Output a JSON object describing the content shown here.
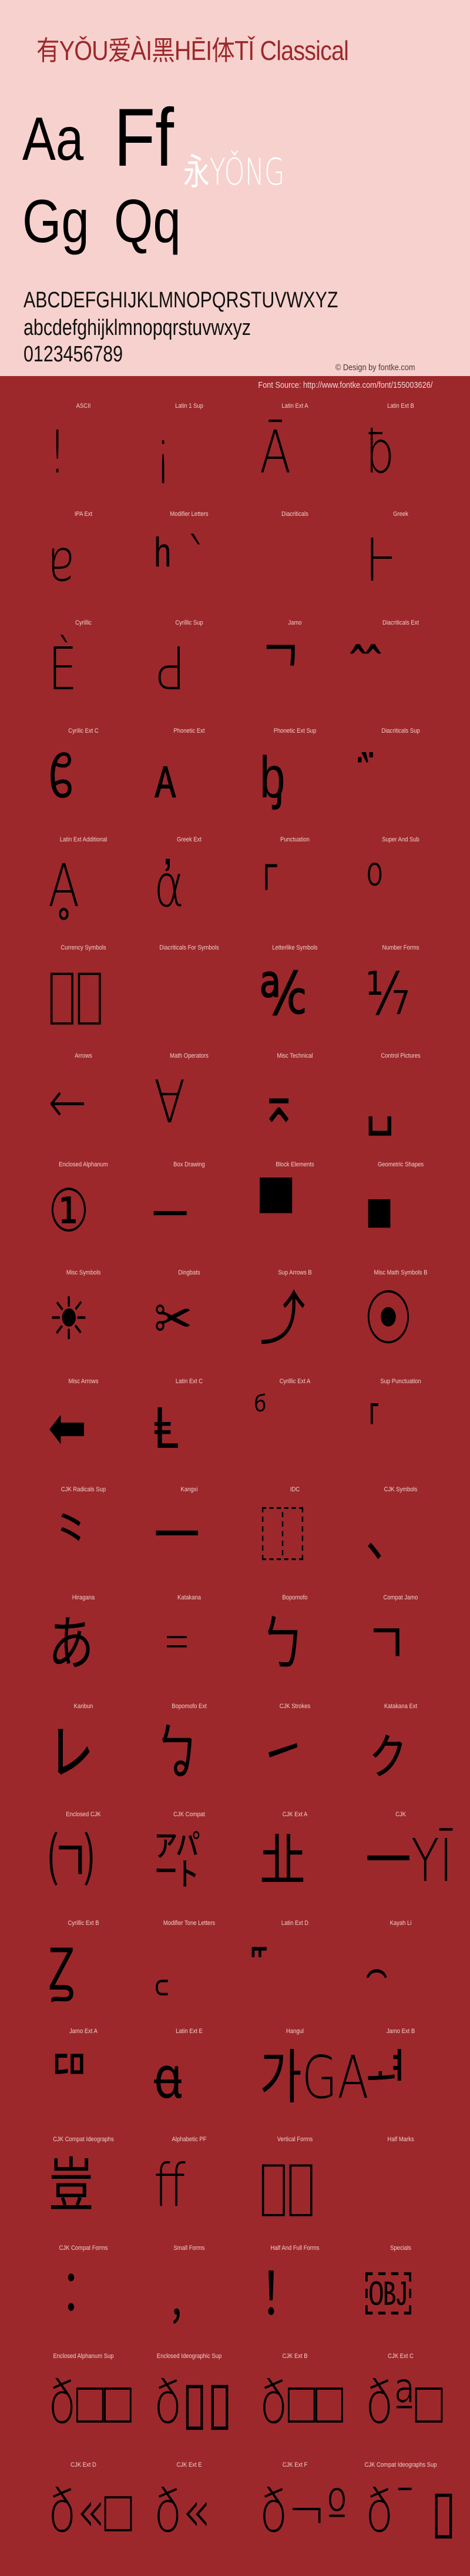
{
  "hero": {
    "title": "有YǑU爱ÀI黑HĒI体TǏ Classical",
    "specimen_pairs": [
      "Aa",
      "Ff",
      "Gg",
      "Qq"
    ],
    "yong": "永YǑNG",
    "uppercase": "ABCDEFGHIJKLMNOPQRSTUVWXYZ",
    "lowercase": "abcdefghijklmnopqrstuvwxyz",
    "digits": "0123456789",
    "copyright": "© Design by fontke.com",
    "source": "Font Source: http://www.fontke.com/font/155003626/"
  },
  "colors": {
    "hero_bg": "#F6D1CD",
    "grid_bg": "#9C282B",
    "title": "#9C282B",
    "yong": "#FFFFFF",
    "glyph": "#000000",
    "label": "#F1CFCB"
  },
  "blocks": [
    {
      "label": "ASCII",
      "glyph": "!"
    },
    {
      "label": "Latin 1 Sup",
      "glyph": "¡"
    },
    {
      "label": "Latin Ext A",
      "glyph": "Ā"
    },
    {
      "label": "Latin Ext B",
      "glyph": "ƀ"
    },
    {
      "label": "IPA Ext",
      "glyph": "ɐ"
    },
    {
      "label": "Modifier Letters",
      "glyph": "ʰ ˋ"
    },
    {
      "label": "Diacriticals",
      "glyph": ""
    },
    {
      "label": "Greek",
      "glyph": "Ͱ"
    },
    {
      "label": "Cyrillic",
      "glyph": "Ѐ"
    },
    {
      "label": "Cyrillic Sup",
      "glyph": "Ԁ"
    },
    {
      "label": "Jamo",
      "glyph": "ᄀ"
    },
    {
      "label": "Diacriticals Ext",
      "glyph": "᪰"
    },
    {
      "label": "Cyrilic Ext C",
      "glyph": "ᲀ"
    },
    {
      "label": "Phonetic Ext",
      "glyph": "ᴀ"
    },
    {
      "label": "Phonetic Ext Sup",
      "glyph": "ᶀ"
    },
    {
      "label": "Diacriticals Sup",
      "glyph": "᷀"
    },
    {
      "label": "Latin Ext Additional",
      "glyph": "Ḁ"
    },
    {
      "label": "Greek Ext",
      "glyph": "ἀ"
    },
    {
      "label": "Punctuation",
      "glyph": "⸀"
    },
    {
      "label": "Super And Sub",
      "glyph": "⁰"
    },
    {
      "label": "Currency Symbols",
      "glyph": "₠⃝"
    },
    {
      "label": "Diacriticals For Symbols",
      "glyph": ""
    },
    {
      "label": "Letterlike Symbols",
      "glyph": "℀"
    },
    {
      "label": "Number Forms",
      "glyph": "⅐"
    },
    {
      "label": "Arrows",
      "glyph": "←"
    },
    {
      "label": "Math Operators",
      "glyph": "∀"
    },
    {
      "label": "Misc Technical",
      "glyph": "⌅"
    },
    {
      "label": "Control Pictures",
      "glyph": "␣"
    },
    {
      "label": "Enclosed Alphanum",
      "glyph": "①"
    },
    {
      "label": "Box Drawing",
      "glyph": "─"
    },
    {
      "label": "Block Elements",
      "glyph": "▀"
    },
    {
      "label": "Geometric Shapes",
      "glyph": "■"
    },
    {
      "label": "Misc Symbols",
      "glyph": "☀"
    },
    {
      "label": "Dingbats",
      "glyph": "✂"
    },
    {
      "label": "Sup Arrows B",
      "glyph": "⤴"
    },
    {
      "label": "Misc Math Symbols B",
      "glyph": "⦿"
    },
    {
      "label": "Misc Arrows",
      "glyph": "⬅"
    },
    {
      "label": "Latin Ext C",
      "glyph": "Ⱡ"
    },
    {
      "label": "Cyrillic Ext A",
      "glyph": "ⷠ"
    },
    {
      "label": "Sup Punctuation",
      "glyph": "⸢"
    },
    {
      "label": "CJK Radicals Sup",
      "glyph": "⺀"
    },
    {
      "label": "Kangxi",
      "glyph": "⼀"
    },
    {
      "label": "IDC",
      "glyph": "⿰"
    },
    {
      "label": "CJK Symbols",
      "glyph": "、"
    },
    {
      "label": "Hiragana",
      "glyph": "あ"
    },
    {
      "label": "Katakana",
      "glyph": "゠"
    },
    {
      "label": "Bopomofo",
      "glyph": "ㄅ"
    },
    {
      "label": "Compat Jamo",
      "glyph": "ㄱ"
    },
    {
      "label": "Kanbun",
      "glyph": "㆑"
    },
    {
      "label": "Bopomofo Ext",
      "glyph": "ㆠ"
    },
    {
      "label": "CJK Strokes",
      "glyph": "㇀"
    },
    {
      "label": "Katakana Ext",
      "glyph": "ㇰ"
    },
    {
      "label": "Enclosed CJK",
      "glyph": "㈀"
    },
    {
      "label": "CJK Compat",
      "glyph": "㌀"
    },
    {
      "label": "CJK Ext A",
      "glyph": "㐀"
    },
    {
      "label": "CJK",
      "glyph": "一YĪ"
    },
    {
      "label": "Cyrillic Ext B",
      "glyph": "Ꙁ"
    },
    {
      "label": "Modifier Tone Letters",
      "glyph": "꜀"
    },
    {
      "label": "Latin Ext D",
      "glyph": "꜠"
    },
    {
      "label": "Kayah Li",
      "glyph": "꤮"
    },
    {
      "label": "Jamo Ext A",
      "glyph": "ꥠ"
    },
    {
      "label": "Latin Ext E",
      "glyph": "ꬰ"
    },
    {
      "label": "Hangul",
      "glyph": "가GA"
    },
    {
      "label": "Jamo Ext B",
      "glyph": "ힰ"
    },
    {
      "label": "CJK Compat Ideographs",
      "glyph": "豈"
    },
    {
      "label": "Alphabetic PF",
      "glyph": "ﬀ"
    },
    {
      "label": "Vertical Forms",
      "glyph": "︖︠"
    },
    {
      "label": "Half Marks",
      "glyph": ""
    },
    {
      "label": "CJK Compat Forms",
      "glyph": "︰"
    },
    {
      "label": "Small Forms",
      "glyph": "﹐"
    },
    {
      "label": "Half And Full Forms",
      "glyph": "！"
    },
    {
      "label": "Specials",
      "glyph": "￼"
    },
    {
      "label": "Enclosed Alphanum Sup",
      "glyph": "ð□□"
    },
    {
      "label": "Enclosed Ideographic Sup",
      "glyph": "ð▯▯"
    },
    {
      "label": "CJK Ext B",
      "glyph": "ð□□"
    },
    {
      "label": "CJK Ext C",
      "glyph": "ðª□"
    },
    {
      "label": "CJK Ext D",
      "glyph": "ð«□"
    },
    {
      "label": "CJK Ext E",
      "glyph": "ð«"
    },
    {
      "label": "CJK Ext F",
      "glyph": "ð¬º"
    },
    {
      "label": "CJK Compat Ideographs Sup",
      "glyph": "ð¯ ▯"
    }
  ]
}
